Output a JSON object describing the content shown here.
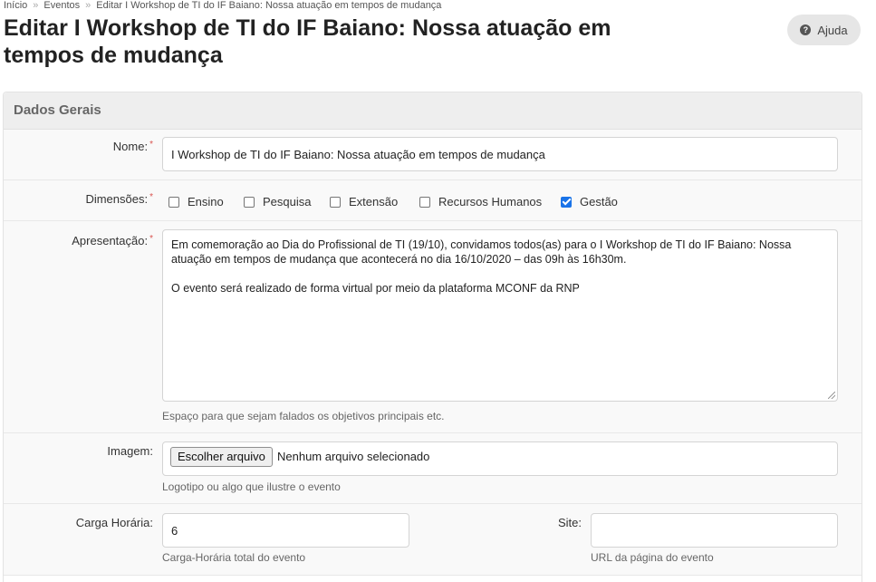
{
  "breadcrumb": [
    {
      "label": "Início"
    },
    {
      "label": "Eventos"
    },
    {
      "label": "Editar I Workshop de TI do IF Baiano: Nossa atuação em tempos de mudança"
    }
  ],
  "page": {
    "title": "Editar I Workshop de TI do IF Baiano: Nossa atuação em tempos de mudança",
    "help_label": "Ajuda"
  },
  "panel": {
    "title": "Dados Gerais"
  },
  "form": {
    "nome": {
      "label": "Nome:",
      "required": "*",
      "value": "I Workshop de TI do IF Baiano: Nossa atuação em tempos de mudança"
    },
    "dimensoes": {
      "label": "Dimensões:",
      "required": "*",
      "options": [
        {
          "label": "Ensino",
          "checked": false
        },
        {
          "label": "Pesquisa",
          "checked": false
        },
        {
          "label": "Extensão",
          "checked": false
        },
        {
          "label": "Recursos Humanos",
          "checked": false
        },
        {
          "label": "Gestão",
          "checked": true
        }
      ]
    },
    "apresentacao": {
      "label": "Apresentação:",
      "required": "*",
      "paragraphs": [
        "Em comemoração ao Dia do Profissional de TI (19/10), convidamos todos(as) para o I Workshop de TI do IF Baiano: Nossa atuação em tempos de mudança que acontecerá no dia 16/10/2020 – das 09h às 16h30m.",
        "O evento será realizado de forma virtual por meio da plataforma MCONF da RNP"
      ],
      "help": "Espaço para que sejam falados os objetivos principais etc."
    },
    "imagem": {
      "label": "Imagem:",
      "button_label": "Escolher arquivo",
      "status": "Nenhum arquivo selecionado",
      "help": "Logotipo ou algo que ilustre o evento"
    },
    "carga_horaria": {
      "label": "Carga Horária:",
      "value": "6",
      "help": "Carga-Horária total do evento"
    },
    "site": {
      "label": "Site:",
      "value": "",
      "help": "URL da página do evento"
    }
  },
  "colors": {
    "accent": "#1a73e8",
    "required": "#d9534f",
    "panel_header_bg": "#eeeeee",
    "row_bg": "#f9f9f9"
  }
}
